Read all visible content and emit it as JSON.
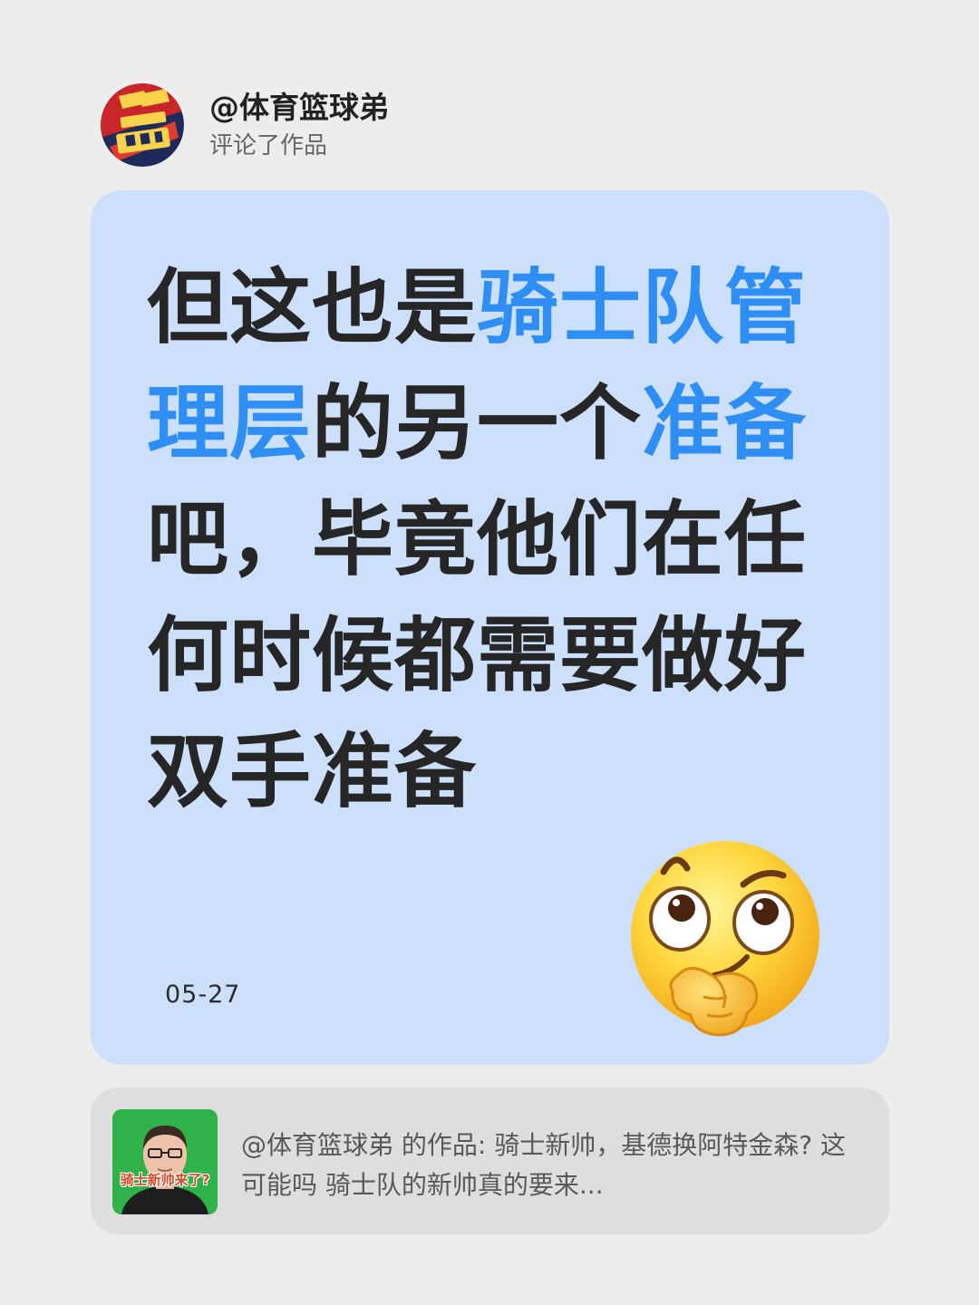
{
  "header": {
    "author": "@体育篮球弟",
    "action": "评论了作品"
  },
  "comment": {
    "parts": [
      "但这也是",
      "骑士队管理层",
      "的另一个",
      "准备",
      "吧，毕竟他们在任何时候都需要做好双手准备"
    ],
    "date": "05-27"
  },
  "reference": {
    "author": "@体育篮球弟",
    "text": " 的作品: 骑士新帅，基德换阿特金森? 这可能吗 骑士队的新帅真的要来...",
    "thumb_caption": "骑士新帅来了?"
  },
  "colors": {
    "page_bg": "#ededed",
    "card_bg": "#cde0fb",
    "highlight": "#2f8ef4",
    "text": "#262626"
  },
  "icons": {
    "avatar": "basketball-logo-icon",
    "emoji": "thinking-face-emoji-icon"
  }
}
